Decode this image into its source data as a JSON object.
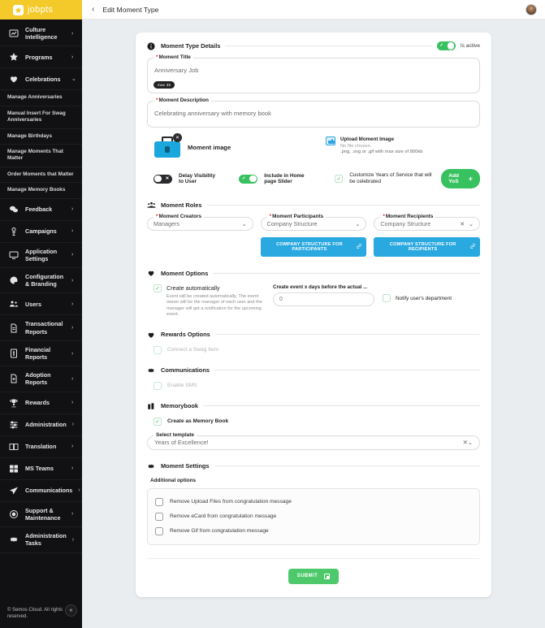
{
  "brand": {
    "logo_text": "jobpts",
    "accent_yellow": "#f3ca2a",
    "green": "#37c15f",
    "blue": "#2aa8e0"
  },
  "sidebar": {
    "items": [
      {
        "label": "Culture Intelligence",
        "icon": "chart-icon",
        "chevron": "›"
      },
      {
        "label": "Programs",
        "icon": "star-icon",
        "chevron": "›"
      },
      {
        "label": "Celebrations",
        "icon": "heart-icon",
        "chevron": "⌄"
      }
    ],
    "sub_items": [
      "Manage Anniversaries",
      "Manual Insert For Swag Anniversaries",
      "Manage Birthdays",
      "Manage Moments That Matter",
      "Order Moments that Matter",
      "Manage Memory Books"
    ],
    "items_after": [
      {
        "label": "Feedback",
        "icon": "chat-icon",
        "chevron": "›"
      },
      {
        "label": "Campaigns",
        "icon": "megaphone-icon",
        "chevron": "›"
      },
      {
        "label": "Application Settings",
        "icon": "monitor-icon",
        "chevron": "›"
      },
      {
        "label": "Configuration & Branding",
        "icon": "palette-icon",
        "chevron": "›"
      },
      {
        "label": "Users",
        "icon": "users-icon",
        "chevron": "›"
      },
      {
        "label": "Transactional Reports",
        "icon": "document-icon",
        "chevron": "›"
      },
      {
        "label": "Financial Reports",
        "icon": "money-doc-icon",
        "chevron": "›"
      },
      {
        "label": "Adoption Reports",
        "icon": "report-icon",
        "chevron": "›"
      },
      {
        "label": "Rewards",
        "icon": "trophy-icon",
        "chevron": "›"
      },
      {
        "label": "Administration",
        "icon": "sliders-icon",
        "chevron": "›"
      },
      {
        "label": "Translation",
        "icon": "translate-icon",
        "chevron": "›"
      },
      {
        "label": "MS Teams",
        "icon": "ms-teams-icon",
        "chevron": "›"
      },
      {
        "label": "Communications",
        "icon": "paper-plane-icon",
        "chevron": "›"
      },
      {
        "label": "Support & Maintenance",
        "icon": "lifebuoy-icon",
        "chevron": "›"
      },
      {
        "label": "Administration Tasks",
        "icon": "gear-icon",
        "chevron": "›"
      }
    ],
    "footer": "© Semos Cloud. All rights reserved.",
    "collapse_label": "«"
  },
  "topbar": {
    "back": "‹",
    "title": "Edit Moment Type"
  },
  "details": {
    "section_title": "Moment Type Details",
    "is_active_label": "Is active",
    "is_active_on": true,
    "title_label": "Moment Title",
    "title_value": "Anniversary Job",
    "title_badge": "max 35",
    "desc_label": "Moment Description",
    "desc_value": "Celebrating anniversary with memory book"
  },
  "image": {
    "caption": "Moment image",
    "remove_icon": "✕",
    "upload_title": "Upload Moment Image",
    "upload_file": "No file chosen.",
    "upload_hint": ".png, .svg or .gif with max size of 800kb"
  },
  "toggles": {
    "delay_label": "Delay Visibility to User",
    "delay_on": false,
    "slider_label": "Include in Home page Slider",
    "slider_on": true,
    "yos_label": "Customize Years of Service that will be celebrated",
    "yos_checked": true,
    "add_yos_button": "Add YoS",
    "add_yos_plus": "+"
  },
  "roles": {
    "section_title": "Moment Roles",
    "creators_label": "Moment Creators",
    "creators_value": "Managers",
    "participants_label": "Moment Participants",
    "participants_value": "Company Structure",
    "recipients_label": "Moment Recipients",
    "recipients_value": "Company Structure",
    "btn_participants": "COMPANY STRUCTURE FOR PARTICIPANTS",
    "btn_recipients": "COMPANY STRUCTURE FOR RECIPIENTS",
    "link_icon": "🔗",
    "clear_icon": "✕",
    "chevron": "⌄"
  },
  "options": {
    "section_title": "Moment Options",
    "create_auto_label": "Create automatically",
    "create_auto_checked": true,
    "create_auto_desc": "Event will be created automatically. The event owner will be the manager of each user and the manager will get a notification for the upcoming event.",
    "days_label": "Create event x days before the actual ...",
    "days_value": "0",
    "notify_label": "Notify user's department",
    "notify_checked": false
  },
  "rewards": {
    "section_title": "Rewards Options",
    "swag_label": "Connect a Swag Item",
    "swag_checked": false
  },
  "communications": {
    "section_title": "Communications",
    "sms_label": "Enable SMS",
    "sms_checked": false
  },
  "memorybook": {
    "section_title": "Memorybook",
    "create_label": "Create as Memory Book",
    "create_checked": true,
    "template_label": "Select template",
    "template_value": "Years of Excellence!",
    "clear_icon": "✕",
    "chevron": "⌄"
  },
  "settings": {
    "section_title": "Moment Settings",
    "additional_label": "Additional options",
    "items": [
      {
        "label": "Remove Upload Files from congratulation message",
        "checked": false
      },
      {
        "label": "Remove eCard from congratulation message",
        "checked": false
      },
      {
        "label": "Remove Gif from congratulation message",
        "checked": false
      }
    ]
  },
  "submit": {
    "label": "SUBMIT",
    "icon": "save-icon"
  }
}
